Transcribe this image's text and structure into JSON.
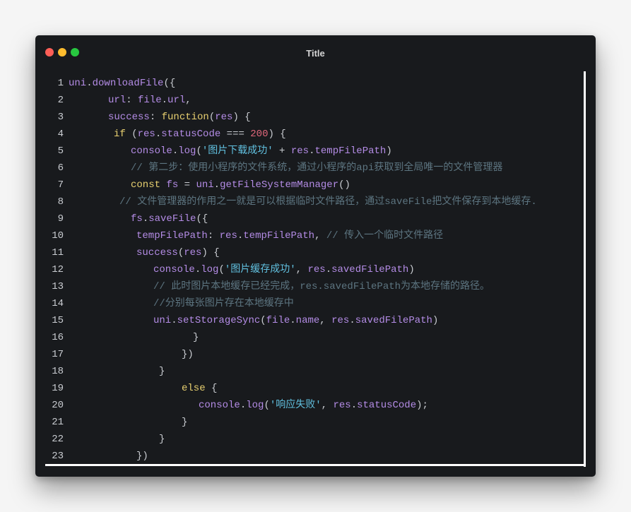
{
  "window": {
    "title": "Title"
  },
  "colors": {
    "background": "#f5f5f5",
    "window": "#181a1d",
    "close": "#fe5f57",
    "minimize": "#febc2e",
    "maximize": "#28c840",
    "keyword": "#e8d070",
    "property": "#b48ce6",
    "string": "#61c0df",
    "number": "#e0677b",
    "comment": "#5d7581"
  },
  "code_lines": [
    {
      "n": "1",
      "indent": 0,
      "tokens": [
        [
          "prop",
          "uni"
        ],
        [
          "plain",
          "."
        ],
        [
          "fn",
          "downloadFile"
        ],
        [
          "plain",
          "({"
        ]
      ]
    },
    {
      "n": "2",
      "indent": 7,
      "tokens": [
        [
          "prop",
          "url"
        ],
        [
          "plain",
          ": "
        ],
        [
          "prop",
          "file"
        ],
        [
          "plain",
          "."
        ],
        [
          "prop",
          "url"
        ],
        [
          "plain",
          ","
        ]
      ]
    },
    {
      "n": "3",
      "indent": 7,
      "tokens": [
        [
          "prop",
          "success"
        ],
        [
          "plain",
          ": "
        ],
        [
          "kw",
          "function"
        ],
        [
          "plain",
          "("
        ],
        [
          "prop",
          "res"
        ],
        [
          "plain",
          ") {"
        ]
      ]
    },
    {
      "n": "4",
      "indent": 8,
      "tokens": [
        [
          "kw",
          "if"
        ],
        [
          "plain",
          " ("
        ],
        [
          "prop",
          "res"
        ],
        [
          "plain",
          "."
        ],
        [
          "prop",
          "statusCode"
        ],
        [
          "plain",
          " === "
        ],
        [
          "num",
          "200"
        ],
        [
          "plain",
          ") {"
        ]
      ]
    },
    {
      "n": "5",
      "indent": 11,
      "tokens": [
        [
          "prop",
          "console"
        ],
        [
          "plain",
          "."
        ],
        [
          "fn",
          "log"
        ],
        [
          "plain",
          "("
        ],
        [
          "str",
          "'图片下载成功'"
        ],
        [
          "plain",
          " + "
        ],
        [
          "prop",
          "res"
        ],
        [
          "plain",
          "."
        ],
        [
          "prop",
          "tempFilePath"
        ],
        [
          "plain",
          ")"
        ]
      ]
    },
    {
      "n": "6",
      "indent": 11,
      "tokens": [
        [
          "cmt",
          "// 第二步：使用小程序的文件系统，通过小程序的api获取到全局唯一的文件管理器"
        ]
      ]
    },
    {
      "n": "7",
      "indent": 11,
      "tokens": [
        [
          "kw",
          "const"
        ],
        [
          "plain",
          " "
        ],
        [
          "prop",
          "fs"
        ],
        [
          "plain",
          " = "
        ],
        [
          "prop",
          "uni"
        ],
        [
          "plain",
          "."
        ],
        [
          "fn",
          "getFileSystemManager"
        ],
        [
          "plain",
          "()"
        ]
      ]
    },
    {
      "n": "8",
      "indent": 9,
      "tokens": [
        [
          "cmt",
          "// 文件管理器的作用之一就是可以根据临时文件路径，通过saveFile把文件保存到本地缓存."
        ]
      ]
    },
    {
      "n": "9",
      "indent": 11,
      "tokens": [
        [
          "prop",
          "fs"
        ],
        [
          "plain",
          "."
        ],
        [
          "fn",
          "saveFile"
        ],
        [
          "plain",
          "({"
        ]
      ]
    },
    {
      "n": "10",
      "indent": 12,
      "tokens": [
        [
          "prop",
          "tempFilePath"
        ],
        [
          "plain",
          ": "
        ],
        [
          "prop",
          "res"
        ],
        [
          "plain",
          "."
        ],
        [
          "prop",
          "tempFilePath"
        ],
        [
          "plain",
          ", "
        ],
        [
          "cmt",
          "// 传入一个临时文件路径"
        ]
      ]
    },
    {
      "n": "11",
      "indent": 12,
      "tokens": [
        [
          "prop",
          "success"
        ],
        [
          "plain",
          "("
        ],
        [
          "prop",
          "res"
        ],
        [
          "plain",
          ") {"
        ]
      ]
    },
    {
      "n": "12",
      "indent": 15,
      "tokens": [
        [
          "prop",
          "console"
        ],
        [
          "plain",
          "."
        ],
        [
          "fn",
          "log"
        ],
        [
          "plain",
          "("
        ],
        [
          "str",
          "'图片缓存成功'"
        ],
        [
          "plain",
          ", "
        ],
        [
          "prop",
          "res"
        ],
        [
          "plain",
          "."
        ],
        [
          "prop",
          "savedFilePath"
        ],
        [
          "plain",
          ")"
        ]
      ]
    },
    {
      "n": "13",
      "indent": 15,
      "tokens": [
        [
          "cmt",
          "// 此时图片本地缓存已经完成，res.savedFilePath为本地存储的路径。"
        ]
      ]
    },
    {
      "n": "14",
      "indent": 15,
      "tokens": [
        [
          "cmt",
          "//分别每张图片存在本地缓存中"
        ]
      ]
    },
    {
      "n": "15",
      "indent": 15,
      "tokens": [
        [
          "prop",
          "uni"
        ],
        [
          "plain",
          "."
        ],
        [
          "fn",
          "setStorageSync"
        ],
        [
          "plain",
          "("
        ],
        [
          "prop",
          "file"
        ],
        [
          "plain",
          "."
        ],
        [
          "prop",
          "name"
        ],
        [
          "plain",
          ", "
        ],
        [
          "prop",
          "res"
        ],
        [
          "plain",
          "."
        ],
        [
          "prop",
          "savedFilePath"
        ],
        [
          "plain",
          ")"
        ]
      ]
    },
    {
      "n": "16",
      "indent": 22,
      "tokens": [
        [
          "plain",
          "}"
        ]
      ]
    },
    {
      "n": "17",
      "indent": 20,
      "tokens": [
        [
          "plain",
          "})"
        ]
      ]
    },
    {
      "n": "18",
      "indent": 16,
      "tokens": [
        [
          "plain",
          "}"
        ]
      ]
    },
    {
      "n": "19",
      "indent": 20,
      "tokens": [
        [
          "kw",
          "else"
        ],
        [
          "plain",
          " {"
        ]
      ]
    },
    {
      "n": "20",
      "indent": 23,
      "tokens": [
        [
          "prop",
          "console"
        ],
        [
          "plain",
          "."
        ],
        [
          "fn",
          "log"
        ],
        [
          "plain",
          "("
        ],
        [
          "str",
          "'响应失败'"
        ],
        [
          "plain",
          ", "
        ],
        [
          "prop",
          "res"
        ],
        [
          "plain",
          "."
        ],
        [
          "prop",
          "statusCode"
        ],
        [
          "plain",
          ");"
        ]
      ]
    },
    {
      "n": "21",
      "indent": 20,
      "tokens": [
        [
          "plain",
          "}"
        ]
      ]
    },
    {
      "n": "22",
      "indent": 16,
      "tokens": [
        [
          "plain",
          "}"
        ]
      ]
    },
    {
      "n": "23",
      "indent": 12,
      "tokens": [
        [
          "plain",
          "})"
        ]
      ]
    }
  ]
}
